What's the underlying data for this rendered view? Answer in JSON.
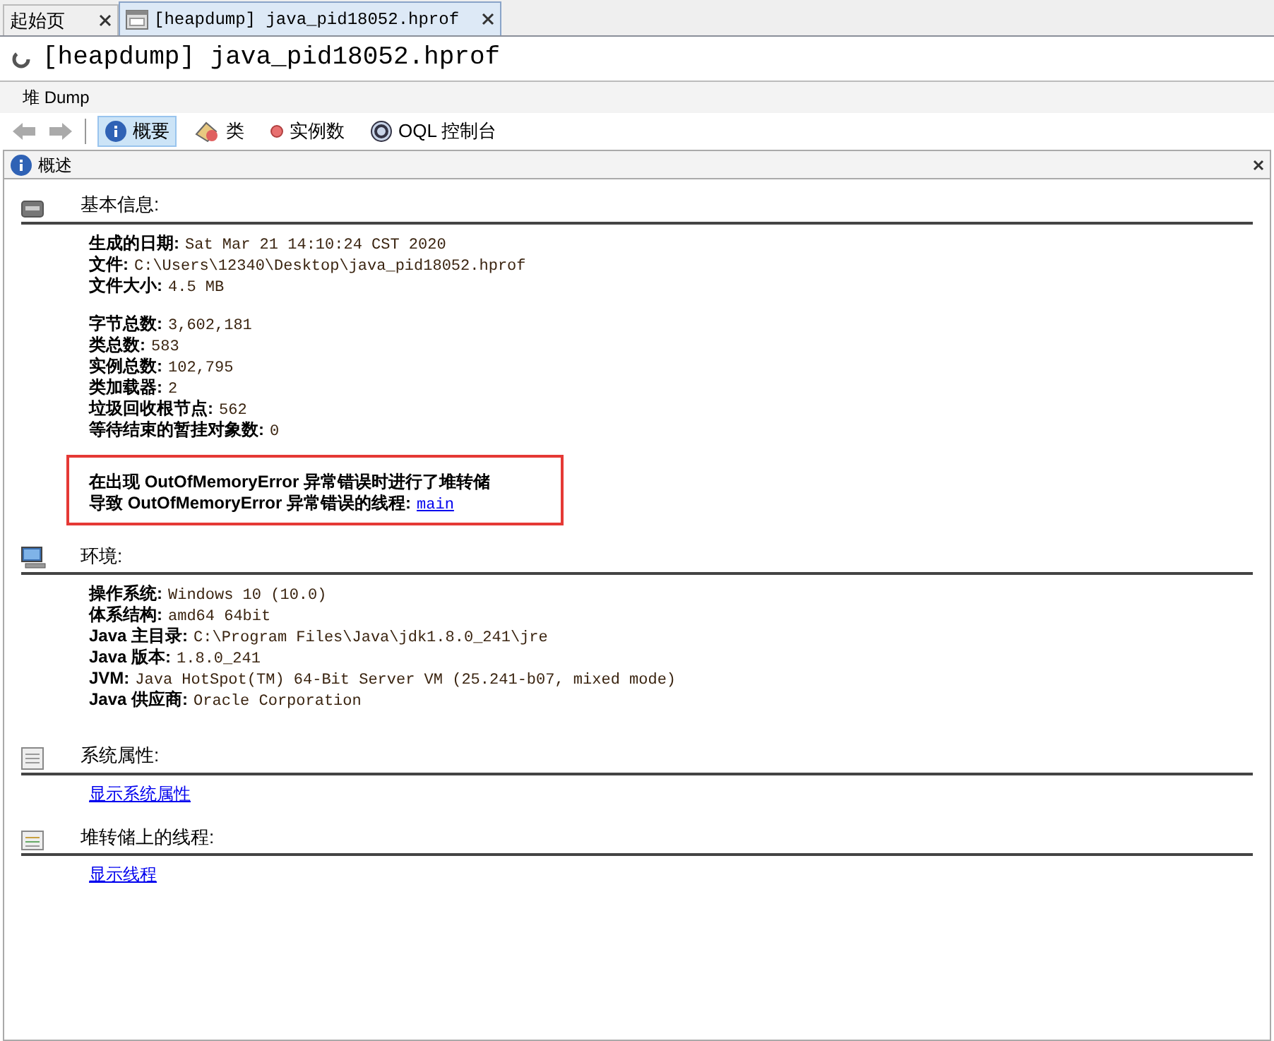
{
  "tabs": [
    {
      "label": "起始页",
      "selected": false,
      "kind": "plain"
    },
    {
      "label": "[heapdump] java_pid18052.hprof",
      "selected": true,
      "kind": "heap"
    }
  ],
  "title": "[heapdump] java_pid18052.hprof",
  "subtab": "堆 Dump",
  "toolbar": [
    {
      "label": "概要",
      "selected": true,
      "kind": "info"
    },
    {
      "label": "类",
      "selected": false,
      "kind": "classes"
    },
    {
      "label": "实例数",
      "selected": false,
      "kind": "instances"
    },
    {
      "label": "OQL 控制台",
      "selected": false,
      "kind": "oql"
    }
  ],
  "panel": {
    "title": "概述",
    "sections": [
      {
        "kind": "basic",
        "title": "基本信息:",
        "groups": [
          [
            {
              "label": "生成的日期:",
              "value": "Sat Mar 21 14:10:24 CST 2020"
            },
            {
              "label": "文件:",
              "value": "C:\\Users\\12340\\Desktop\\java_pid18052.hprof"
            },
            {
              "label": "文件大小:",
              "value": "4.5 MB"
            }
          ],
          [
            {
              "label": "字节总数:",
              "value": "3,602,181"
            },
            {
              "label": "类总数:",
              "value": "583"
            },
            {
              "label": "实例总数:",
              "value": "102,795"
            },
            {
              "label": "类加载器:",
              "value": "2"
            },
            {
              "label": "垃圾回收根节点:",
              "value": "562"
            },
            {
              "label": "等待结束的暂挂对象数:",
              "value": "0"
            }
          ]
        ],
        "notice": {
          "lines": [
            "在出现 OutOfMemoryError 异常错误时进行了堆转储",
            "导致 OutOfMemoryError 异常错误的线程:"
          ],
          "link": "main"
        }
      },
      {
        "kind": "environment",
        "title": "环境:",
        "groups": [
          [
            {
              "label": "操作系统:",
              "value": "Windows 10 (10.0)"
            },
            {
              "label": "体系结构:",
              "value": "amd64 64bit"
            },
            {
              "label": "Java 主目录:",
              "value": "C:\\Program Files\\Java\\jdk1.8.0_241\\jre"
            },
            {
              "label": "Java 版本:",
              "value": "1.8.0_241"
            },
            {
              "label": "JVM:",
              "value": "Java HotSpot(TM) 64-Bit Server VM (25.241-b07, mixed mode)"
            },
            {
              "label": "Java 供应商:",
              "value": "Oracle Corporation"
            }
          ]
        ]
      },
      {
        "kind": "properties",
        "title": "系统属性:",
        "link": "显示系统属性"
      },
      {
        "kind": "threads",
        "title": "堆转储上的线程:",
        "link": "显示线程"
      }
    ]
  }
}
